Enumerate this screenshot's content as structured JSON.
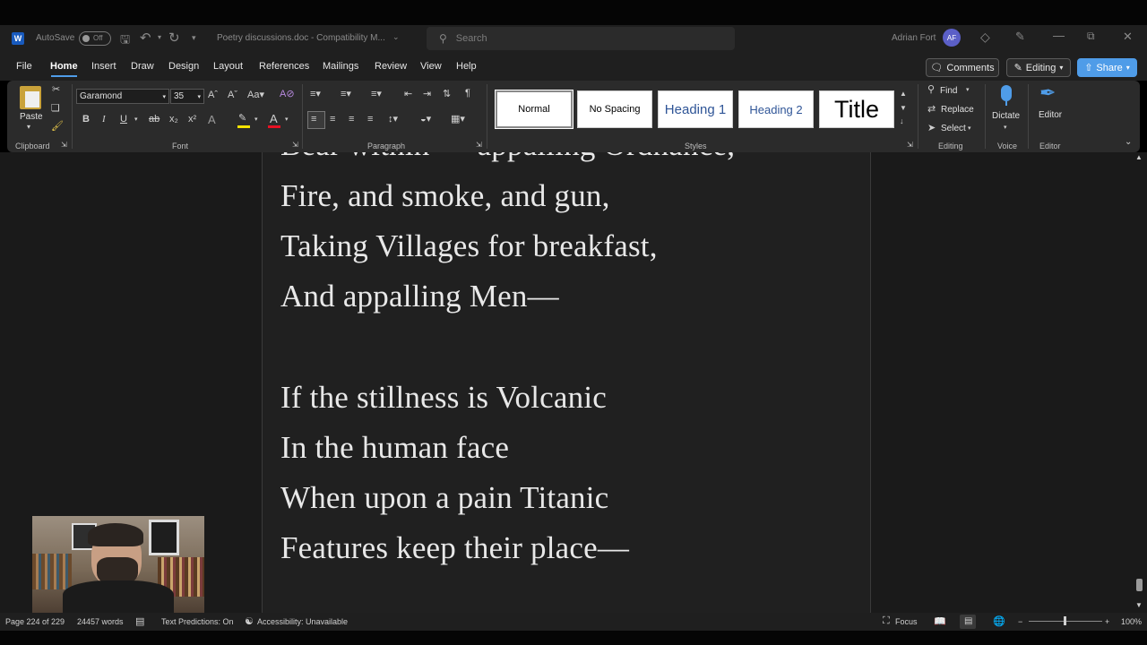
{
  "titlebar": {
    "autosave_label": "AutoSave",
    "autosave_state": "Off",
    "doc_title": "Poetry discussions.doc  -  Compatibility M...",
    "search_placeholder": "Search",
    "user_name": "Adrian Fort",
    "user_initials": "AF"
  },
  "menu": {
    "tabs": [
      "File",
      "Home",
      "Insert",
      "Draw",
      "Design",
      "Layout",
      "References",
      "Mailings",
      "Review",
      "View",
      "Help"
    ],
    "active_tab": "Home",
    "comments_label": "Comments",
    "editing_label": "Editing",
    "share_label": "Share"
  },
  "ribbon": {
    "clipboard": {
      "paste_label": "Paste",
      "group_label": "Clipboard"
    },
    "font": {
      "font_name": "Garamond",
      "font_size": "35",
      "group_label": "Font",
      "bold": "B",
      "italic": "I",
      "underline": "U",
      "strike": "ab",
      "subscript": "x₂",
      "superscript": "x²"
    },
    "paragraph": {
      "group_label": "Paragraph"
    },
    "styles": {
      "group_label": "Styles",
      "items": [
        "Normal",
        "No Spacing",
        "Heading 1",
        "Heading 2",
        "Title"
      ],
      "selected": "Normal"
    },
    "editing": {
      "find_label": "Find",
      "replace_label": "Replace",
      "select_label": "Select",
      "group_label": "Editing"
    },
    "voice": {
      "dictate_label": "Dictate",
      "group_label": "Voice"
    },
    "editor": {
      "editor_label": "Editor",
      "group_label": "Editor"
    }
  },
  "document": {
    "partial_line": "Bear within — appalling Ordnance,",
    "lines": [
      "Fire, and smoke, and gun,",
      "Taking Villages for breakfast,",
      "And appalling Men—",
      "",
      "If the stillness is Volcanic",
      "In the human face",
      "When upon a pain Titanic",
      "Features keep their place—"
    ]
  },
  "statusbar": {
    "page_info": "Page 224 of 229",
    "word_count": "24457 words",
    "text_predictions": "Text Predictions: On",
    "accessibility": "Accessibility: Unavailable",
    "focus_label": "Focus",
    "zoom": "100%"
  },
  "colors": {
    "accent": "#4f9ce8",
    "word_blue": "#185abd",
    "avatar": "#5b5fc7",
    "highlight_yellow": "#f5e300",
    "font_red": "#e81123"
  }
}
